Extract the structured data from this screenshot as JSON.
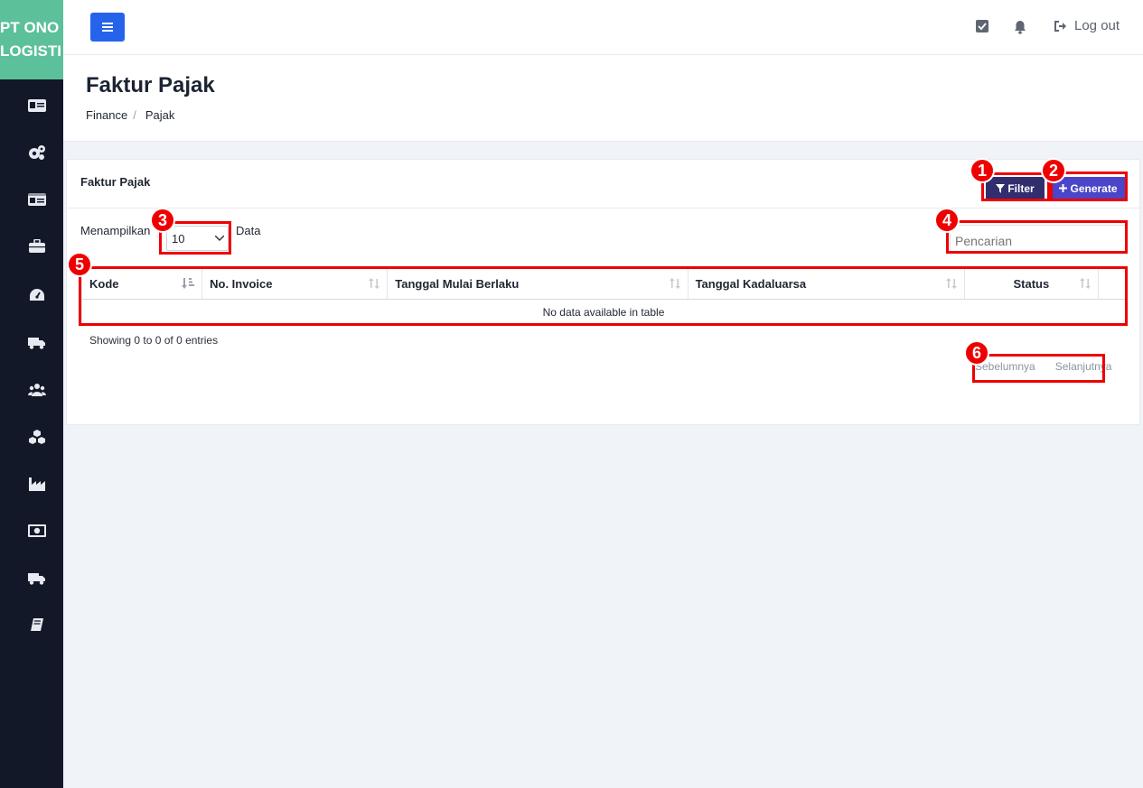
{
  "brand": {
    "line1": "PT ONO",
    "line2": "LOGISTI"
  },
  "sidebar": {
    "icons": [
      "id-card-icon",
      "cogs-icon",
      "id-card-alt-icon",
      "briefcase-icon",
      "dashboard-icon",
      "truck-icon",
      "users-icon",
      "cubes-icon",
      "industry-icon",
      "money-bill-icon",
      "truck-alt-icon",
      "book-icon"
    ]
  },
  "topbar": {
    "menu_icon": "bars-icon",
    "tasks_icon": "check-square-icon",
    "notif_icon": "bell-icon",
    "logout_label": "Log out"
  },
  "header": {
    "title": "Faktur Pajak",
    "breadcrumb": [
      "Finance",
      "Pajak"
    ],
    "breadcrumb_sep": "/"
  },
  "card": {
    "title": "Faktur Pajak",
    "filter_label": "Filter",
    "generate_label": "Generate",
    "length_prefix": "Menampilkan",
    "length_value": "10",
    "length_suffix": "Data",
    "search_placeholder": "Pencarian",
    "columns": [
      "Kode",
      "No. Invoice",
      "Tanggal Mulai Berlaku",
      "Tanggal Kadaluarsa",
      "Status"
    ],
    "empty_message": "No data available in table",
    "info": "Showing 0 to 0 of 0 entries",
    "prev_label": "Sebelumnya",
    "next_label": "Selanjutnya"
  },
  "annotations": [
    "1",
    "2",
    "3",
    "4",
    "5",
    "6"
  ],
  "colors": {
    "sidebar": "#121828",
    "brand": "#5cc09a",
    "primary": "#2563eb",
    "filter_btn": "#312e6e",
    "generate_btn": "#4b45c9",
    "annotation": "#ee0000"
  }
}
